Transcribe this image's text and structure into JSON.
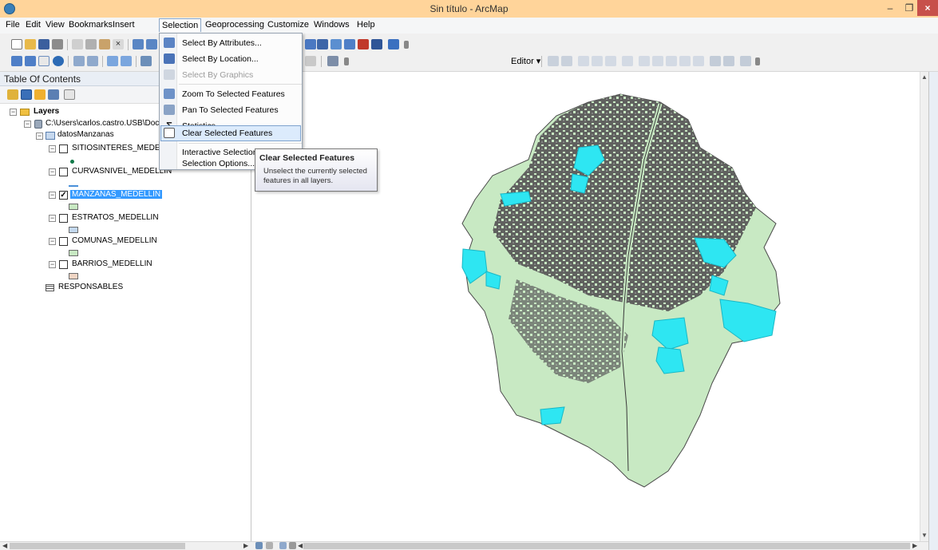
{
  "window": {
    "title": "Sin título - ArcMap"
  },
  "menubar": {
    "items": [
      "File",
      "Edit",
      "View",
      "Bookmarks",
      "Insert",
      "Selection",
      "Geoprocessing",
      "Customize",
      "Windows",
      "Help"
    ],
    "open": "Selection"
  },
  "toolbar": {
    "editor_label": "Editor ▾"
  },
  "toc": {
    "title": "Table Of Contents",
    "tree": {
      "root": "Layers",
      "path": "C:\\Users\\carlos.castro.USB\\Docu",
      "dataset": "datosManzanas",
      "layers": [
        {
          "name": "SITIOSINTERES_MEDELLIN",
          "checked": false,
          "symbol": "point",
          "symbol_color": "#127a4a"
        },
        {
          "name": "CURVASNIVEL_MEDELLIN",
          "checked": false,
          "symbol": "line",
          "symbol_color": "#4a90d9"
        },
        {
          "name": "MANZANAS_MEDELLIN",
          "checked": true,
          "selected": true,
          "symbol": "fill",
          "symbol_color": "#c8e9c3"
        },
        {
          "name": "ESTRATOS_MEDELLIN",
          "checked": false,
          "symbol": "fill",
          "symbol_color": "#c3d8ee"
        },
        {
          "name": "COMUNAS_MEDELLIN",
          "checked": false,
          "symbol": "fill",
          "symbol_color": "#c8e9c3"
        },
        {
          "name": "BARRIOS_MEDELLIN",
          "checked": false,
          "symbol": "fill",
          "symbol_color": "#f0d5c4"
        }
      ],
      "table": "RESPONSABLES"
    }
  },
  "selection_menu": {
    "items": [
      {
        "label": "Select By Attributes...",
        "icon": "select-by-attributes-icon",
        "disabled": false
      },
      {
        "label": "Select By Location...",
        "icon": "select-by-location-icon",
        "disabled": false
      },
      {
        "label": "Select By Graphics",
        "icon": "select-by-graphics-icon",
        "disabled": true
      },
      {
        "label": "Zoom To Selected Features",
        "icon": "zoom-to-selected-icon",
        "disabled": false
      },
      {
        "label": "Pan To Selected Features",
        "icon": "pan-to-selected-icon",
        "disabled": false
      },
      {
        "label": "Statistics...",
        "icon": "sigma-icon",
        "disabled": false
      },
      {
        "label": "Clear Selected Features",
        "icon": "clear-selection-icon",
        "disabled": false,
        "highlighted": true
      },
      {
        "label": "Interactive Selection Method",
        "icon": "",
        "disabled": false,
        "submenu": true
      },
      {
        "label": "Selection Options...",
        "icon": "",
        "disabled": false
      }
    ]
  },
  "tooltip": {
    "title": "Clear Selected Features",
    "body": "Unselect the currently selected features in all layers."
  },
  "colors": {
    "titlebar": "#ffd49a",
    "map_fill": "#c8e9c3",
    "map_lines": "#555555",
    "selection": "#2ee6f2",
    "highlight": "#dcebfc"
  }
}
